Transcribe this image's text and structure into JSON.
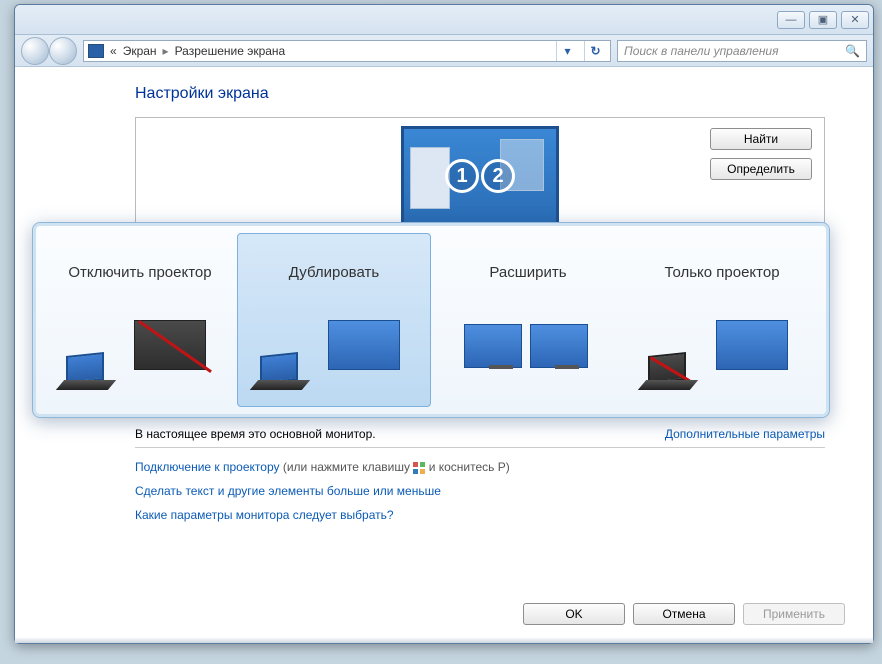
{
  "titlebar": {
    "min": "—",
    "max": "▣",
    "close": "✕"
  },
  "breadcrumb": {
    "prefix": "«",
    "level1": "Экран",
    "sep": "▸",
    "level2": "Разрешение экрана"
  },
  "addr_dropdown": "▾",
  "addr_refresh": "↻",
  "search": {
    "placeholder": "Поиск в панели управления",
    "icon": "🔍"
  },
  "page_title": "Настройки экрана",
  "preview": {
    "num1": "1",
    "num2": "2"
  },
  "buttons": {
    "find": "Найти",
    "identify": "Определить",
    "ok": "OK",
    "cancel": "Отмена",
    "apply": "Применить"
  },
  "projector": {
    "options": [
      {
        "label": "Отключить проектор"
      },
      {
        "label": "Дублировать"
      },
      {
        "label": "Расширить"
      },
      {
        "label": "Только проектор"
      }
    ],
    "selected_index": 1
  },
  "status_text": "В настоящее время это основной монитор.",
  "advanced_link": "Дополнительные параметры",
  "links": {
    "connect_projector": "Подключение к проектору",
    "connect_projector_hint_a": " (или нажмите клавишу ",
    "connect_projector_hint_b": " и коснитесь P)",
    "text_size": "Сделать текст и другие элементы больше или меньше",
    "which_monitor": "Какие параметры монитора следует выбрать?"
  }
}
